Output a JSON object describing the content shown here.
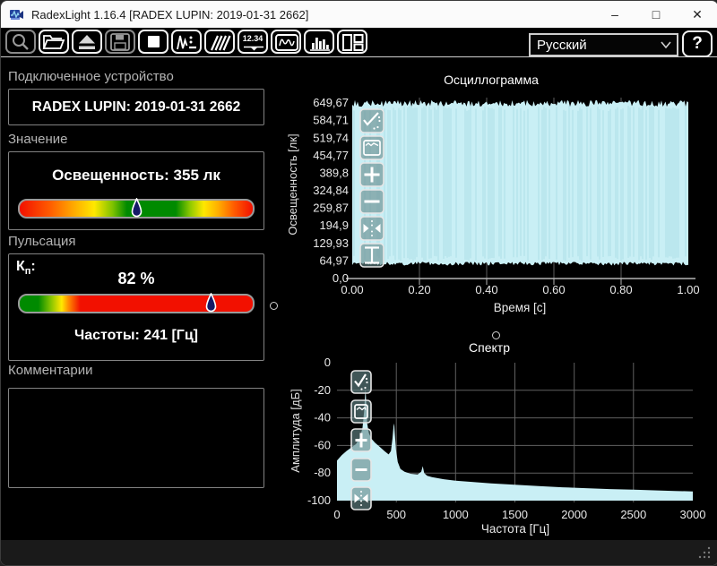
{
  "window": {
    "title": "RadexLight 1.16.4 [RADEX LUPIN: 2019-01-31 2662]",
    "controls": {
      "minimize": "–",
      "maximize": "□",
      "close": "✕"
    }
  },
  "toolbar": {
    "buttons": [
      {
        "name": "zoom-tool",
        "icon": "magnifier-icon",
        "disabled": true
      },
      {
        "name": "open-file",
        "icon": "folder-open-icon",
        "disabled": false
      },
      {
        "name": "eject-device",
        "icon": "eject-icon",
        "disabled": false
      },
      {
        "name": "save-file",
        "icon": "floppy-icon",
        "disabled": true
      },
      {
        "name": "stop-measurement",
        "icon": "stop-icon",
        "disabled": false
      },
      {
        "name": "measurement-mode",
        "icon": "waveform-dots-icon",
        "disabled": false
      },
      {
        "name": "sensor-mode",
        "icon": "hatch-icon",
        "disabled": false
      },
      {
        "name": "numeric-display-view",
        "icon": "digits-icon",
        "label": "12.34",
        "disabled": false
      },
      {
        "name": "oscillogram-view",
        "icon": "wave-box-icon",
        "disabled": false
      },
      {
        "name": "spectrum-view",
        "icon": "bar-chart-icon",
        "disabled": false
      },
      {
        "name": "layout-view",
        "icon": "panels-icon",
        "disabled": false
      }
    ],
    "language_select": {
      "value": "Русский"
    },
    "help_label": "?"
  },
  "device_panel": {
    "header": "Подключенное устройство",
    "device_name": "RADEX LUPIN: 2019-01-31 2662"
  },
  "value_panel": {
    "header": "Значение",
    "reading": "Освещенность: 355 лк",
    "marker_percent": 50
  },
  "pulsation_panel": {
    "header": "Пульсация",
    "kp_main": "К",
    "kp_sub": "п",
    "kp_colon": ":",
    "kp_value": "82 %",
    "marker_percent": 82,
    "frequency": "Частоты: 241 [Гц]"
  },
  "comments_panel": {
    "header": "Комментарии",
    "text": ""
  },
  "palette": {
    "chart_fill": "#c9eff5",
    "good": "#008a00",
    "warn": "#ffe800",
    "bad": "#f21000"
  },
  "chart_data": [
    {
      "id": "osc",
      "type": "area",
      "title": "Осциллограмма",
      "xlabel": "Время [с]",
      "ylabel": "Освещенность [лк]",
      "xlim": [
        0,
        1.0
      ],
      "ylim": [
        0,
        670
      ],
      "x_ticks": [
        "0.00",
        "0.20",
        "0.40",
        "0.60",
        "0.80",
        "1.00"
      ],
      "x_tick_values": [
        0,
        0.2,
        0.4,
        0.6,
        0.8,
        1.0
      ],
      "y_ticks": [
        "649,67",
        "584,71",
        "519,74",
        "454,77",
        "389,8",
        "324,84",
        "259,87",
        "194,9",
        "129,93",
        "64,97",
        "0,0"
      ],
      "y_tick_values": [
        649.67,
        584.71,
        519.74,
        454.77,
        389.8,
        324.84,
        259.87,
        194.9,
        129.93,
        64.97,
        0
      ],
      "waveform": "dense oscillation filling envelope between bottom and top for full 1 s window",
      "envelope": {
        "top_lux": 650,
        "bottom_lux": 55,
        "top_jitter_lux": 25,
        "bottom_jitter_lux": 14
      },
      "grid": true,
      "tools": [
        "auto-scale",
        "fit-view",
        "zoom-in",
        "zoom-out",
        "fit-horizontal",
        "fit-vertical"
      ]
    },
    {
      "id": "spec",
      "type": "area",
      "title": "Спектр",
      "xlabel": "Частота [Гц]",
      "ylabel": "Амплитуда [дБ]",
      "xlim": [
        0,
        3000
      ],
      "ylim": [
        -100,
        0
      ],
      "x_ticks": [
        "0",
        "500",
        "1000",
        "1500",
        "2000",
        "2500",
        "3000"
      ],
      "x_tick_values": [
        0,
        500,
        1000,
        1500,
        2000,
        2500,
        3000
      ],
      "y_ticks": [
        "0",
        "-20",
        "-40",
        "-60",
        "-80",
        "-100"
      ],
      "y_tick_values": [
        0,
        -20,
        -40,
        -60,
        -80,
        -100
      ],
      "peaks_hz": [
        241,
        482,
        723
      ],
      "points": [
        [
          0,
          -71
        ],
        [
          40,
          -67
        ],
        [
          80,
          -64
        ],
        [
          120,
          -61.5
        ],
        [
          160,
          -59
        ],
        [
          195,
          -54
        ],
        [
          215,
          -47
        ],
        [
          228,
          -36
        ],
        [
          236,
          -25
        ],
        [
          241,
          -19
        ],
        [
          247,
          -30
        ],
        [
          255,
          -44
        ],
        [
          268,
          -51
        ],
        [
          290,
          -55
        ],
        [
          320,
          -58
        ],
        [
          360,
          -61
        ],
        [
          400,
          -64
        ],
        [
          435,
          -66.5
        ],
        [
          455,
          -64
        ],
        [
          468,
          -55
        ],
        [
          477,
          -46
        ],
        [
          482,
          -44
        ],
        [
          488,
          -52
        ],
        [
          497,
          -63
        ],
        [
          512,
          -72
        ],
        [
          535,
          -77
        ],
        [
          570,
          -79
        ],
        [
          620,
          -80.5
        ],
        [
          680,
          -81
        ],
        [
          710,
          -79
        ],
        [
          723,
          -75
        ],
        [
          735,
          -80
        ],
        [
          760,
          -82
        ],
        [
          800,
          -83
        ],
        [
          900,
          -84.5
        ],
        [
          1000,
          -85.5
        ],
        [
          1150,
          -86.5
        ],
        [
          1300,
          -87.5
        ],
        [
          1500,
          -88.5
        ],
        [
          1700,
          -89.5
        ],
        [
          1900,
          -90.3
        ],
        [
          2100,
          -91
        ],
        [
          2300,
          -91.6
        ],
        [
          2500,
          -92.1
        ],
        [
          2700,
          -92.6
        ],
        [
          2850,
          -93
        ],
        [
          3000,
          -93.3
        ]
      ],
      "grid": true,
      "tools": [
        "auto-scale",
        "fit-view",
        "zoom-in",
        "zoom-out",
        "fit-horizontal"
      ]
    }
  ]
}
